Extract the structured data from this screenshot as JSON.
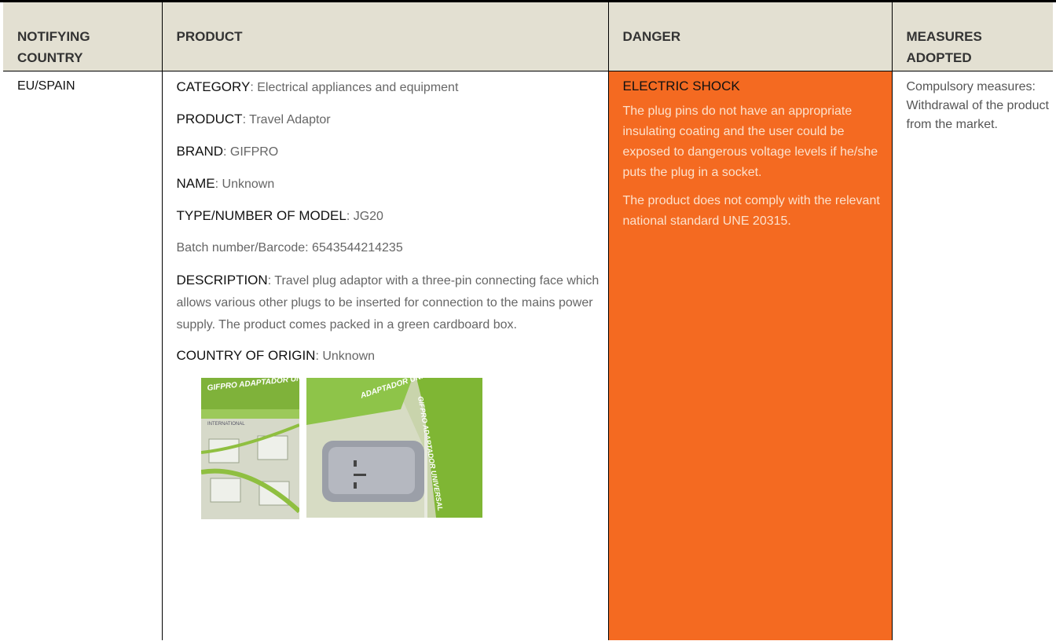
{
  "headers": {
    "country": "NOTIFYING COUNTRY",
    "product": "PRODUCT",
    "danger": "DANGER",
    "measures": "MEASURES ADOPTED"
  },
  "row": {
    "country": "EU/SPAIN",
    "product": {
      "category_key": "CATEGORY",
      "category_value": "Electrical appliances and equipment",
      "product_key": "PRODUCT",
      "product_value": "Travel Adaptor",
      "brand_key": "BRAND",
      "brand_value": "GIFPRO",
      "name_key": "NAME",
      "name_value": "Unknown",
      "model_key": "TYPE/NUMBER OF MODEL",
      "model_value": "JG20",
      "batch": "Batch number/Barcode: 6543544214235",
      "description_key": "DESCRIPTION",
      "description_value": "Travel plug adaptor with a three-pin connecting face which allows various other plugs to be inserted for connection to the mains power supply. The product comes packed in a green cardboard box.",
      "origin_key": "COUNTRY OF ORIGIN",
      "origin_value": "Unknown",
      "photo_1_text": "GIFPRO ADAPTADOR UNIVERSAL",
      "photo_1_subtext": "INTERNATIONAL",
      "photo_2_text": "GIFPRO ADAPTADOR UNIVERSAL",
      "photo_2_side": "ADAPTADOR UNIVERSAL"
    },
    "danger": {
      "title": "ELECTRIC SHOCK",
      "paragraph_1": "The plug pins do not have an appropriate insulating coating and the user could be exposed to dangerous voltage levels if he/she puts the plug in a socket.",
      "paragraph_2": "The product does not comply with the relevant national standard UNE 20315."
    },
    "measures": "Compulsory measures: Withdrawal of the product from the market."
  },
  "colors": {
    "header_bg": "#e3e0d2",
    "danger_bg": "#f46a21",
    "danger_text": "#fde1cc"
  }
}
